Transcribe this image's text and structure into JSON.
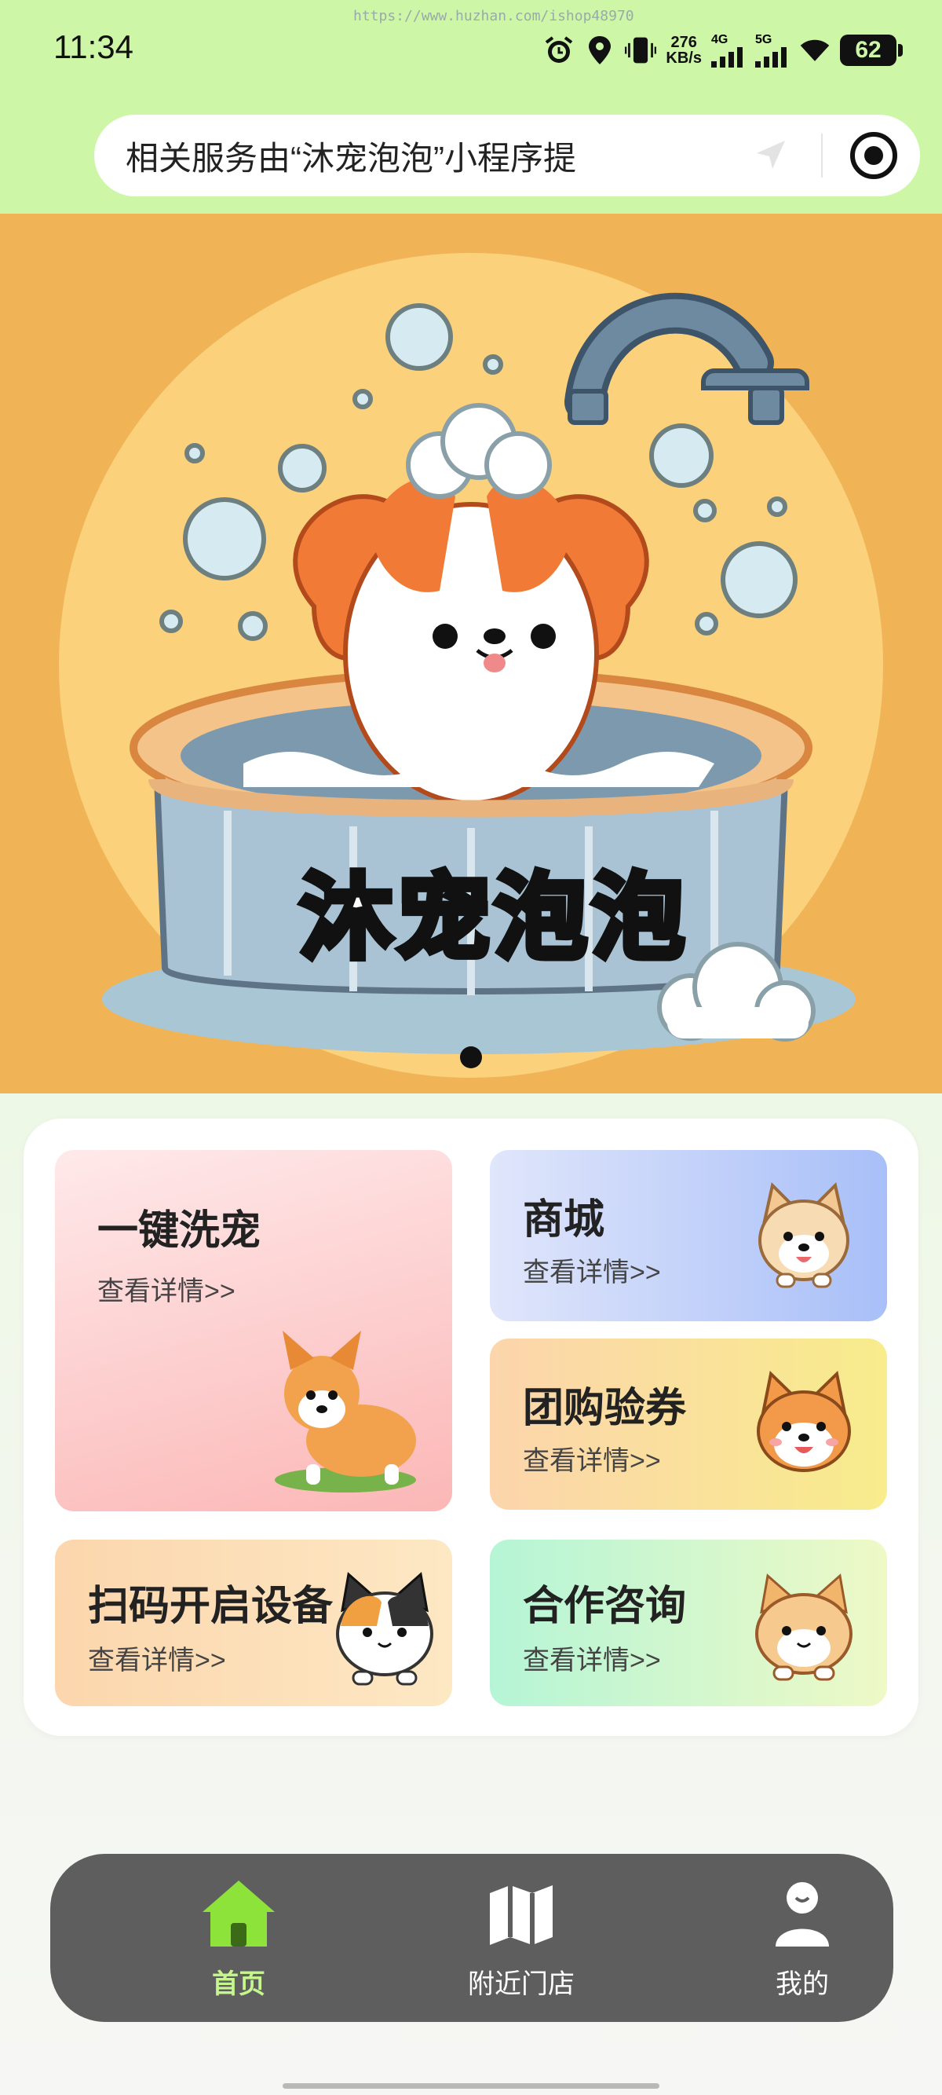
{
  "status_bar": {
    "time": "11:34",
    "watermark": "https://www.huzhan.com/ishop48970",
    "net_speed_value": "276",
    "net_speed_unit": "KB/s",
    "signal_1": "4G",
    "signal_2": "5G",
    "battery": "62",
    "icons": [
      "alarm-icon",
      "location-icon",
      "vibrate-icon",
      "signal-icon",
      "wifi-icon",
      "battery-icon"
    ]
  },
  "notice": {
    "text": "相关服务由“沐宠泡泡”小程序提",
    "icons": [
      "navigation-arrow-icon",
      "capsule-target-icon"
    ]
  },
  "banner": {
    "brand_text": "沐宠泡泡",
    "indicator_count": 1,
    "active_index": 0
  },
  "menu": {
    "wash": {
      "title": "一键洗宠",
      "subtitle": "查看详情>>",
      "icon": "corgi-illustration"
    },
    "shop": {
      "title": "商城",
      "subtitle": "查看详情>>",
      "icon": "shiba-illustration"
    },
    "group": {
      "title": "团购验券",
      "subtitle": "查看详情>>",
      "icon": "corgi-head-illustration"
    },
    "scan": {
      "title": "扫码开启设备",
      "subtitle": "查看详情>>",
      "icon": "calico-cat-illustration"
    },
    "coop": {
      "title": "合作咨询",
      "subtitle": "查看详情>>",
      "icon": "orange-cat-illustration"
    }
  },
  "tabbar": {
    "active_color": "#c6f78e",
    "items": [
      {
        "label": "首页",
        "icon": "home-icon",
        "active": true
      },
      {
        "label": "附近门店",
        "icon": "map-icon",
        "active": false
      },
      {
        "label": "我的",
        "icon": "user-icon",
        "active": false
      }
    ]
  },
  "colors": {
    "header_bg": "#cdf7a6",
    "banner_bg": "#f0b457",
    "tabbar_bg": "#5e5e5e"
  }
}
